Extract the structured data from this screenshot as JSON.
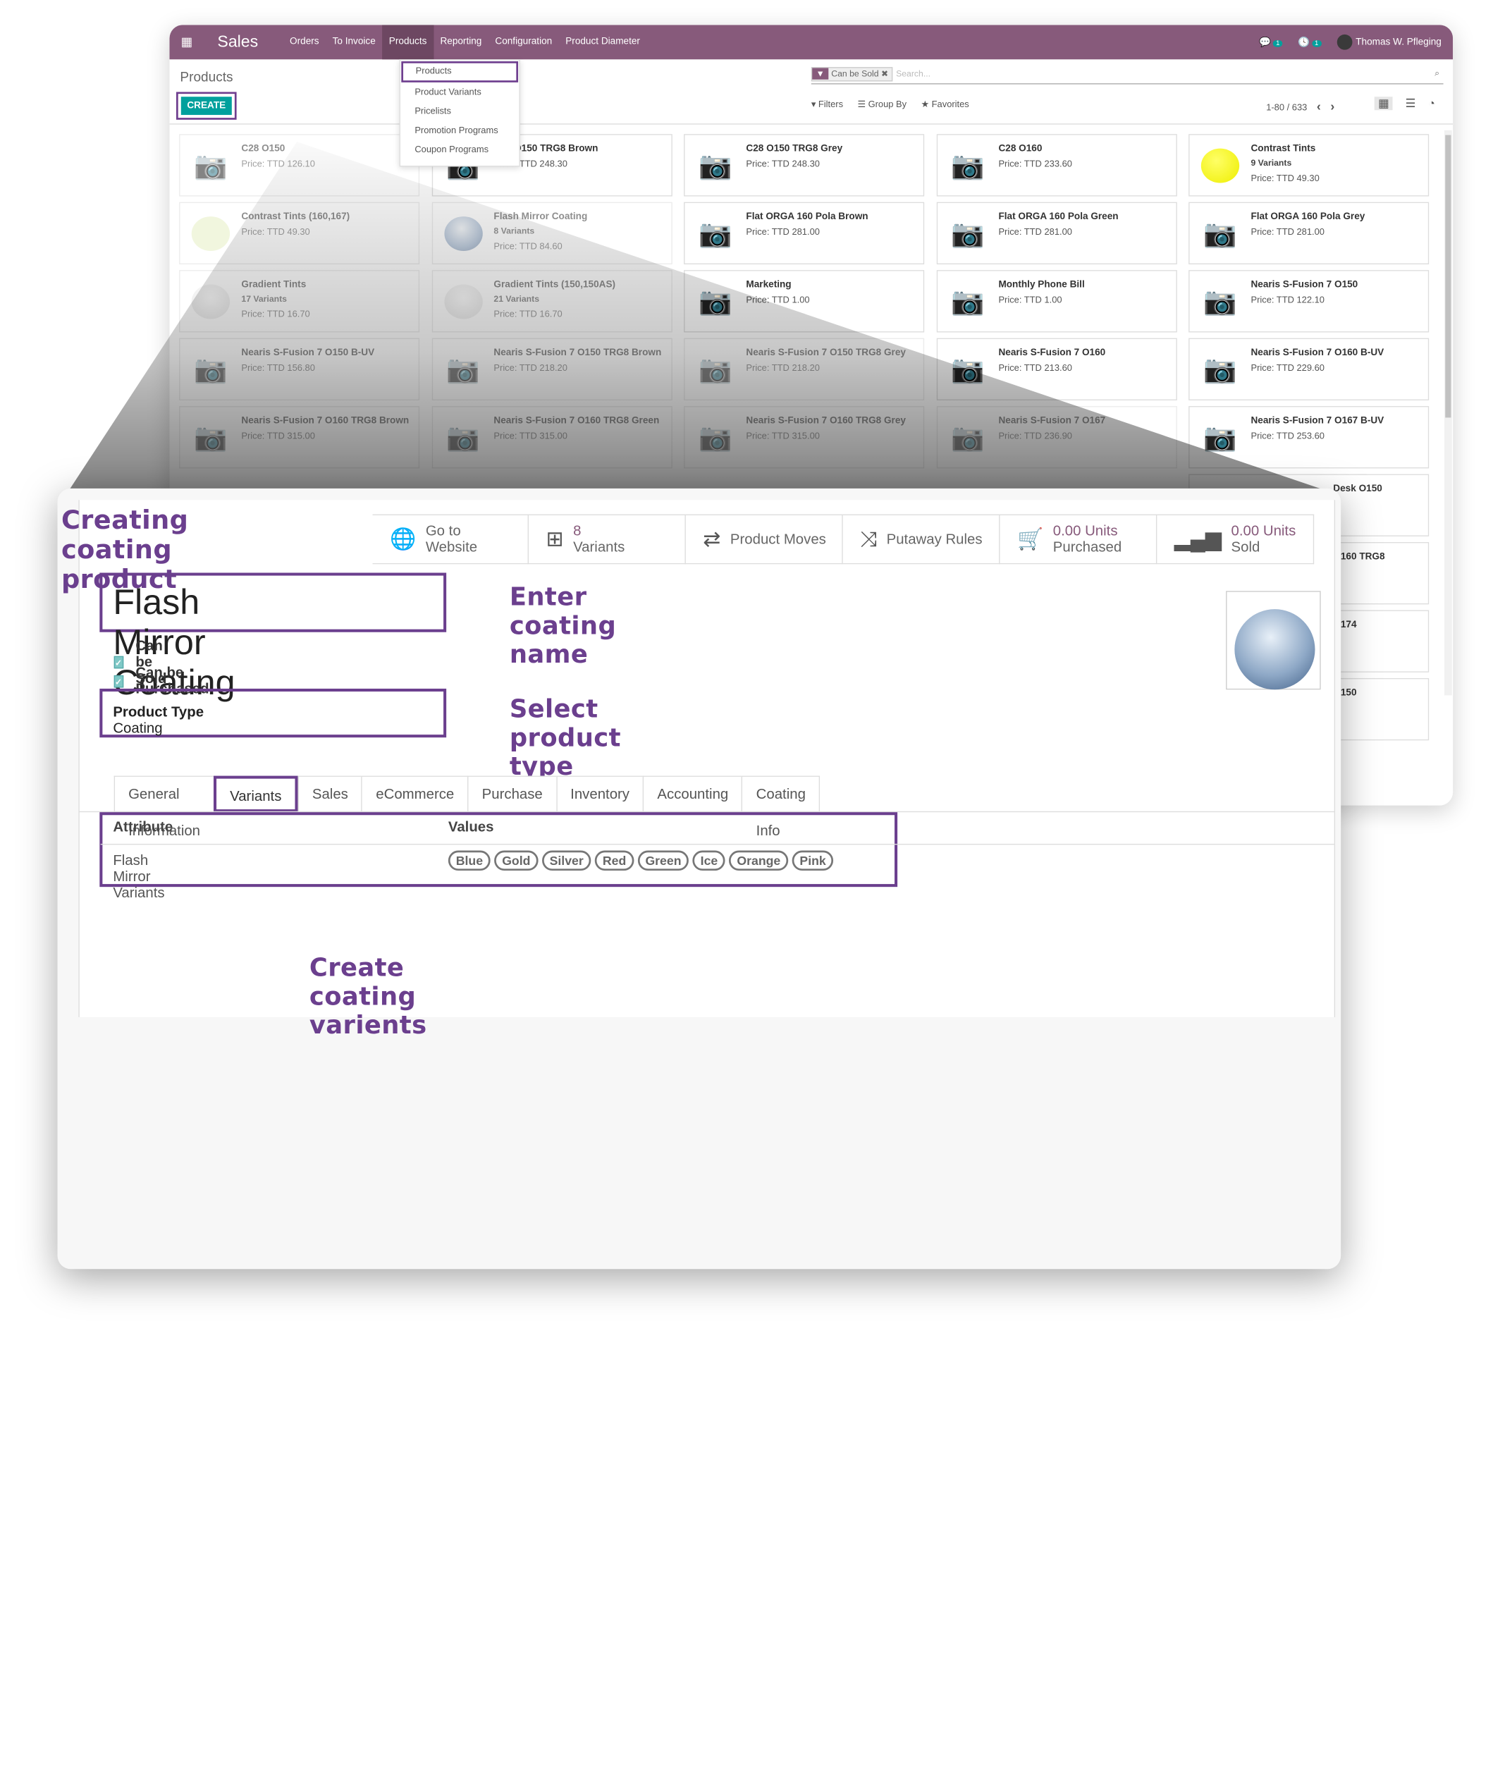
{
  "app": {
    "name": "Sales",
    "menu": [
      "Orders",
      "To Invoice",
      "Products",
      "Reporting",
      "Configuration",
      "Product Diameter"
    ],
    "active_menu": "Products",
    "messages_count": "1",
    "activities_count": "1",
    "user": "Thomas W. Pfleging"
  },
  "products_menu": [
    "Products",
    "Product Variants",
    "Pricelists",
    "Promotion Programs",
    "Coupon Programs"
  ],
  "page": {
    "title": "Products",
    "create_label": "CREATE"
  },
  "search": {
    "facet": "Can be Sold",
    "placeholder": "Search..."
  },
  "filters": [
    "Filters",
    "Group By",
    "Favorites"
  ],
  "pager": "1-80 / 633",
  "cards": [
    {
      "name": "C28 O150",
      "variants": "",
      "price": "Price: TTD 126.10",
      "img": "cam",
      "faded": true
    },
    {
      "name": "C28 O150 TRG8 Brown",
      "variants": "",
      "price": "Price: TTD 248.30",
      "img": "cam",
      "faded": false
    },
    {
      "name": "C28 O150 TRG8 Grey",
      "variants": "",
      "price": "Price: TTD 248.30",
      "img": "cam",
      "faded": false
    },
    {
      "name": "C28 O160",
      "variants": "",
      "price": "Price: TTD 233.60",
      "img": "cam",
      "faded": false
    },
    {
      "name": "Contrast Tints",
      "variants": "9 Variants",
      "price": "Price: TTD 49.30",
      "img": "yellow",
      "faded": false
    },
    {
      "name": "Contrast Tints (160,167)",
      "variants": "",
      "price": "Price: TTD 49.30",
      "img": "pale",
      "faded": true
    },
    {
      "name": "Flash Mirror Coating",
      "variants": "8 Variants",
      "price": "Price: TTD 84.60",
      "img": "mirror",
      "faded": true
    },
    {
      "name": "Flat ORGA 160 Pola Brown",
      "variants": "",
      "price": "Price: TTD 281.00",
      "img": "cam",
      "faded": false
    },
    {
      "name": "Flat ORGA 160 Pola Green",
      "variants": "",
      "price": "Price: TTD 281.00",
      "img": "cam",
      "faded": false
    },
    {
      "name": "Flat ORGA 160 Pola Grey",
      "variants": "",
      "price": "Price: TTD 281.00",
      "img": "cam",
      "faded": false
    },
    {
      "name": "Gradient Tints",
      "variants": "17 Variants",
      "price": "Price: TTD 16.70",
      "img": "grad",
      "faded": true
    },
    {
      "name": "Gradient Tints (150,150AS)",
      "variants": "21 Variants",
      "price": "Price: TTD 16.70",
      "img": "grad",
      "faded": true
    },
    {
      "name": "Marketing",
      "variants": "",
      "price": "Price: TTD 1.00",
      "img": "cam",
      "faded": false
    },
    {
      "name": "Monthly Phone Bill",
      "variants": "",
      "price": "Price: TTD 1.00",
      "img": "cam",
      "faded": false
    },
    {
      "name": "Nearis S-Fusion 7 O150",
      "variants": "",
      "price": "Price: TTD 122.10",
      "img": "cam",
      "faded": false
    },
    {
      "name": "Nearis S-Fusion 7 O150 B-UV",
      "variants": "",
      "price": "Price: TTD 156.80",
      "img": "cam",
      "faded": true
    },
    {
      "name": "Nearis S-Fusion 7 O150 TRG8 Brown",
      "variants": "",
      "price": "Price: TTD 218.20",
      "img": "cam",
      "faded": true
    },
    {
      "name": "Nearis S-Fusion 7 O150 TRG8 Grey",
      "variants": "",
      "price": "Price: TTD 218.20",
      "img": "cam",
      "faded": true
    },
    {
      "name": "Nearis S-Fusion 7 O160",
      "variants": "",
      "price": "Price: TTD 213.60",
      "img": "cam",
      "faded": false
    },
    {
      "name": "Nearis S-Fusion 7 O160 B-UV",
      "variants": "",
      "price": "Price: TTD 229.60",
      "img": "cam",
      "faded": false
    },
    {
      "name": "Nearis S-Fusion 7 O160 TRG8 Brown",
      "variants": "",
      "price": "Price: TTD 315.00",
      "img": "cam",
      "faded": true
    },
    {
      "name": "Nearis S-Fusion 7 O160 TRG8 Green",
      "variants": "",
      "price": "Price: TTD 315.00",
      "img": "cam",
      "faded": true
    },
    {
      "name": "Nearis S-Fusion 7 O160 TRG8 Grey",
      "variants": "",
      "price": "Price: TTD 315.00",
      "img": "cam",
      "faded": true
    },
    {
      "name": "Nearis S-Fusion 7 O167",
      "variants": "",
      "price": "Price: TTD 236.90",
      "img": "cam",
      "faded": true
    },
    {
      "name": "Nearis S-Fusion 7 O167 B-UV",
      "variants": "",
      "price": "Price: TTD 253.60",
      "img": "cam",
      "faded": false
    }
  ],
  "partial_cards": [
    "Desk O150",
    "O160 TRG8",
    "O174",
    "O150"
  ],
  "form": {
    "smart_buttons": [
      {
        "line1": "Go to",
        "line2": "Website",
        "icon": "globe-icon"
      },
      {
        "line1": "8",
        "line2": "Variants",
        "icon": "sitemap-icon"
      },
      {
        "line1": "Product Moves",
        "line2": "",
        "icon": "exchange-icon"
      },
      {
        "line1": "Putaway Rules",
        "line2": "",
        "icon": "random-icon"
      },
      {
        "line1": "0.00 Units",
        "line2": "Purchased",
        "icon": "cart-icon"
      },
      {
        "line1": "0.00 Units",
        "line2": "Sold",
        "icon": "signal-icon"
      }
    ],
    "product_name": "Flash Mirror Coating",
    "can_be_sold": "Can be Sold",
    "can_be_purchased": "Can be Purchased",
    "product_type_label": "Product Type",
    "product_type_value": "Coating",
    "tabs": [
      "General Information",
      "Variants",
      "Sales",
      "eCommerce",
      "Purchase",
      "Inventory",
      "Accounting",
      "Coating Info"
    ],
    "active_tab": "Variants",
    "table_headers": [
      "Attribute",
      "Values"
    ],
    "attribute": "Flash Mirror Variants",
    "values": [
      "Blue",
      "Gold",
      "Silver",
      "Red",
      "Green",
      "Ice",
      "Orange",
      "Pink"
    ]
  },
  "annotations": {
    "title": "Creating coating product",
    "name": "Enter coating name",
    "type": "Select product type",
    "variants": "Create coating varients"
  },
  "colors": {
    "brand": "#875a7b",
    "accent": "#00a09d",
    "annotation": "#6b3f8e"
  }
}
